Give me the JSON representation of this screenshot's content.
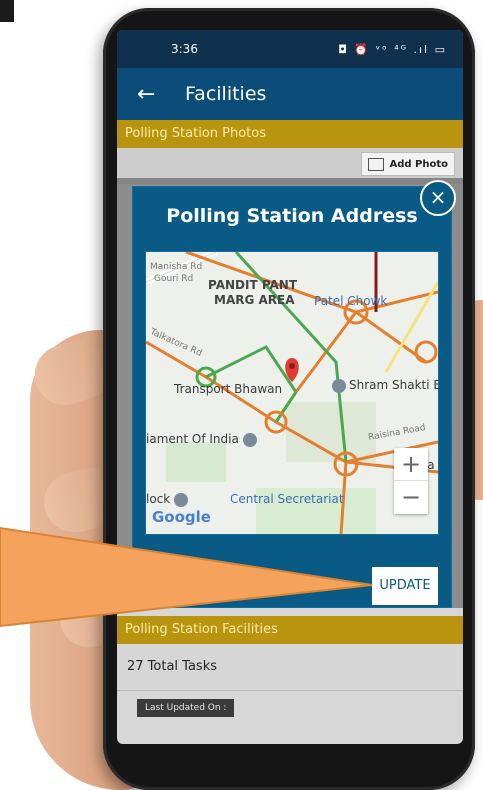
{
  "status_bar": {
    "time": "3:36",
    "icons": "◘ ⏰ ᵛᵒ ⁴ᴳ .ıl ▭"
  },
  "app_bar": {
    "back_icon": "←",
    "title": "Facilities"
  },
  "sections": {
    "photos_header": "Polling Station Photos",
    "add_photo_label": "Add Photo",
    "facilities_header": "Polling Station Facilities",
    "total_tasks": "27 Total Tasks",
    "last_updated": "Last Updated On :"
  },
  "modal": {
    "title": "Polling Station Address",
    "close_icon": "×",
    "update_label": "UPDATE",
    "map": {
      "labels": {
        "manisha": "Manisha Rd",
        "gouri": "Gouri Rd",
        "pandit1": "PANDIT PANT",
        "pandit2": "MARG AREA",
        "patel": "Patel Chowk",
        "talkatora": "Talkatora Rd",
        "transport": "Transport Bhawan",
        "shram": "Shram Shakti B",
        "parliament": "iament Of India",
        "raisina": "Raisina Road",
        "sha": "Sha",
        "block": "lock",
        "central": "Central Secretariat",
        "google": "Google"
      },
      "zoom_in": "+",
      "zoom_out": "−"
    }
  },
  "colors": {
    "app_bar": "#0b4d78",
    "status_bar": "#10314d",
    "section_header": "#b8940f",
    "modal": "#0a5a86",
    "callout": "#f5a35c"
  }
}
